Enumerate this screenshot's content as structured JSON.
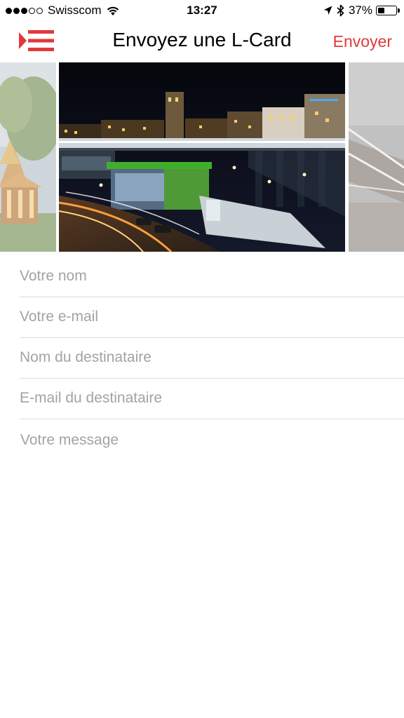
{
  "status_bar": {
    "signal_filled": 3,
    "signal_total": 5,
    "carrier": "Swisscom",
    "time": "13:27",
    "battery_text": "37%",
    "battery_level": 0.37
  },
  "nav": {
    "title": "Envoyez une L-Card",
    "send_label": "Envoyer",
    "menu_icon": "menu-lines-icon",
    "accent_color": "#e2383b"
  },
  "carousel": {
    "slides": [
      {
        "name": "thai-pavilion-photo"
      },
      {
        "name": "lausanne-flon-night-photo"
      },
      {
        "name": "architecture-detail-photo"
      }
    ]
  },
  "form": {
    "name_placeholder": "Votre nom",
    "email_placeholder": "Votre e-mail",
    "recipient_name_placeholder": "Nom du destinataire",
    "recipient_email_placeholder": "E-mail du destinataire",
    "message_placeholder": "Votre message"
  }
}
